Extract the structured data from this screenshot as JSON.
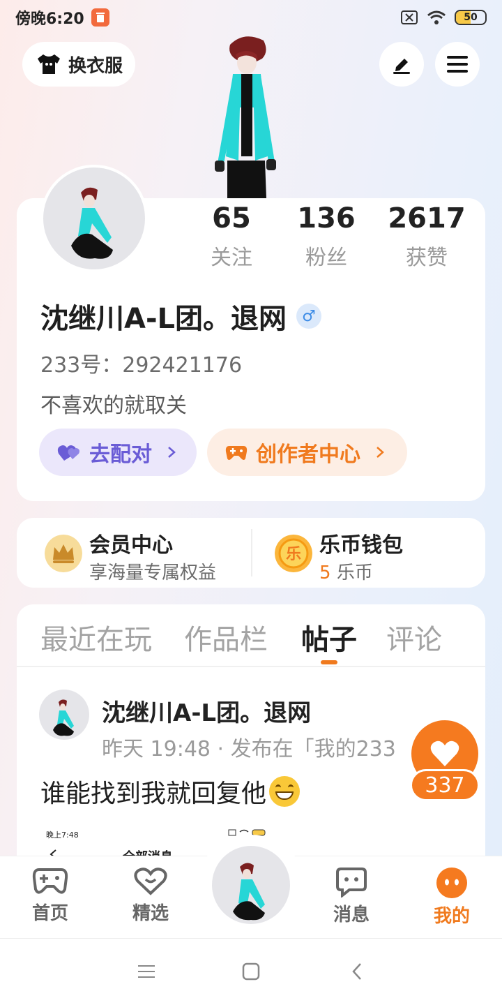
{
  "status_bar": {
    "time": "傍晚6:20",
    "battery": "50"
  },
  "header": {
    "outfit_label": "换衣服"
  },
  "stats": [
    {
      "value": "65",
      "label": "关注"
    },
    {
      "value": "136",
      "label": "粉丝"
    },
    {
      "value": "2617",
      "label": "获赞"
    }
  ],
  "profile": {
    "username": "沈继川A-L团。退网",
    "gender": "♂",
    "user_id": "233号：292421176",
    "bio": "不喜欢的就取关",
    "match_label": "去配对",
    "creator_label": "创作者中心"
  },
  "vip": {
    "title": "会员中心",
    "subtitle": "享海量专属权益"
  },
  "wallet": {
    "title": "乐币钱包",
    "icon_text": "乐",
    "amount": "5",
    "unit": "乐币"
  },
  "tabs": [
    {
      "label": "最近在玩"
    },
    {
      "label": "作品栏"
    },
    {
      "label": "帖子"
    },
    {
      "label": "评论"
    }
  ],
  "post": {
    "author": "沈继川A-L团。退网",
    "meta": "昨天 19:48 · 发布在「我的233",
    "text": "谁能找到我就回复他",
    "thumb_time": "晚上7:48",
    "thumb_title": "全部消息 -"
  },
  "likes": {
    "count": "337"
  },
  "bottom_nav": [
    {
      "label": "首页"
    },
    {
      "label": "精选"
    },
    {
      "label": "消息"
    },
    {
      "label": "我的"
    }
  ],
  "colors": {
    "accent": "#f07a1e",
    "purple": "#6a5cd6",
    "male_blue": "#3c8be6"
  }
}
